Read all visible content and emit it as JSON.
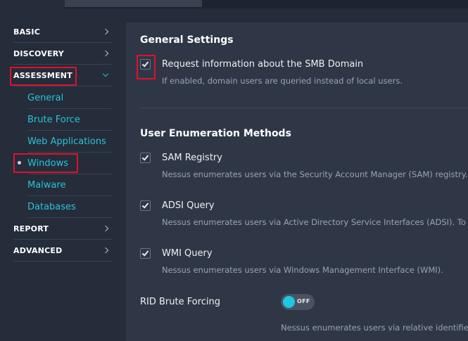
{
  "colors": {
    "accent": "#28c3d8",
    "highlight_box": "#e0112b",
    "sidebar_bg": "#252c3a",
    "content_bg": "#2f3746"
  },
  "sidebar": {
    "sections": [
      {
        "label": "BASIC"
      },
      {
        "label": "DISCOVERY"
      },
      {
        "label": "ASSESSMENT",
        "expanded": true
      },
      {
        "label": "REPORT"
      },
      {
        "label": "ADVANCED"
      }
    ],
    "assessment_items": [
      {
        "label": "General"
      },
      {
        "label": "Brute Force"
      },
      {
        "label": "Web Applications"
      },
      {
        "label": "Windows",
        "active": true
      },
      {
        "label": "Malware"
      },
      {
        "label": "Databases"
      }
    ]
  },
  "main": {
    "general_settings": {
      "title": "General Settings",
      "options": [
        {
          "label": "Request information about the SMB Domain",
          "description": "If enabled, domain users are queried instead of local users.",
          "checked": true
        }
      ]
    },
    "user_enumeration": {
      "title": "User Enumeration Methods",
      "options": [
        {
          "label": "SAM Registry",
          "description": "Nessus enumerates users via the Security Account Manager (SAM) registry.",
          "checked": true
        },
        {
          "label": "ADSI Query",
          "description": "Nessus enumerates users via Active Directory Service Interfaces (ADSI). To use",
          "checked": true
        },
        {
          "label": "WMI Query",
          "description": "Nessus enumerates users via Windows Management Interface (WMI).",
          "checked": true
        }
      ]
    },
    "rid_brute": {
      "label": "RID Brute Forcing",
      "toggle_state": "OFF",
      "description": "Nessus enumerates users via relative identifier (R"
    }
  }
}
